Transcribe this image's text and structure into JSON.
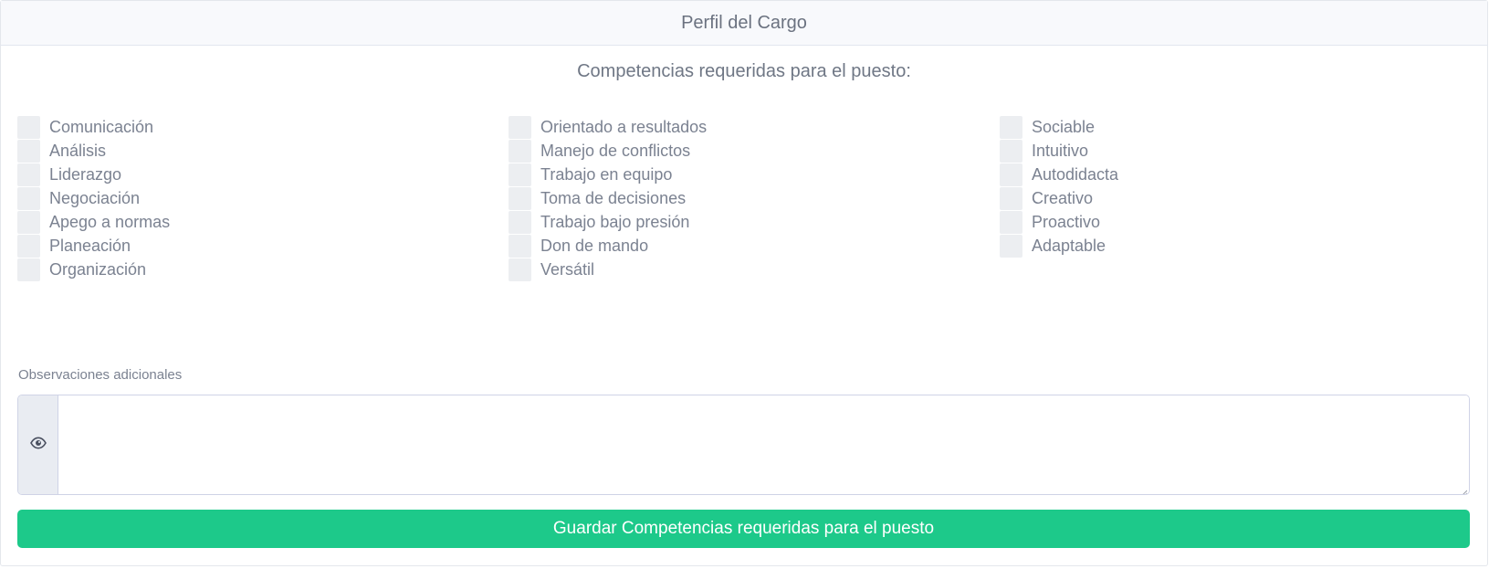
{
  "card": {
    "title": "Perfil del Cargo"
  },
  "section": {
    "title": "Competencias requeridas para el puesto:"
  },
  "competencies": {
    "column1": [
      "Comunicación",
      "Análisis",
      "Liderazgo",
      "Negociación",
      "Apego a normas",
      "Planeación",
      "Organización"
    ],
    "column2": [
      "Orientado a resultados",
      "Manejo de conflictos",
      "Trabajo en equipo",
      "Toma de decisiones",
      "Trabajo bajo presión",
      "Don de mando",
      "Versátil"
    ],
    "column3": [
      "Sociable",
      "Intuitivo",
      "Autodidacta",
      "Creativo",
      "Proactivo",
      "Adaptable"
    ]
  },
  "observations": {
    "label": "Observaciones adicionales",
    "value": "",
    "addon_icon": "eye-icon"
  },
  "actions": {
    "save_label": "Guardar Competencias requeridas para el puesto"
  },
  "colors": {
    "accent": "#1dc98a",
    "header_bg": "#f8f9fc",
    "checkbox_bg": "#eceef1",
    "text_muted": "#7b8291"
  }
}
